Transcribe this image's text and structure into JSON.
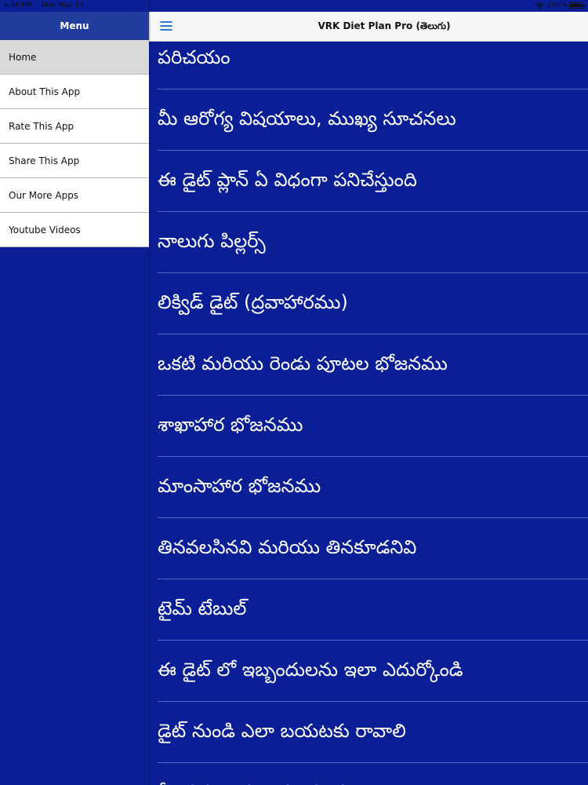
{
  "status_bar": {
    "time": "4:34 PM",
    "date": "Mon May 13",
    "battery": "100%",
    "battery_level": 1.0
  },
  "sidebar": {
    "title": "Menu",
    "items": [
      {
        "label": "Home",
        "active": true
      },
      {
        "label": "About This App"
      },
      {
        "label": "Rate This App"
      },
      {
        "label": "Share This App"
      },
      {
        "label": "Our More Apps"
      },
      {
        "label": "Youtube Videos"
      }
    ]
  },
  "nav": {
    "title": "VRK Diet Plan Pro (తెలుగు)"
  },
  "topics": [
    "పరిచయం",
    "మీ ఆరోగ్య విషయాలు, ముఖ్య సూచనలు",
    "ఈ డైట్ ప్లాన్ ఏ విధంగా పనిచేస్తుంది",
    "నాలుగు పిల్లర్స్",
    "లిక్విడ్ డైట్ (ద్రవాహారము)",
    "ఒకటి మరియు రెండు పూటల భోజనము",
    "శాఖాహార భోజనము",
    "మాంసాహార భోజనము",
    "తినవలసినవి మరియు తినకూడనివి",
    "టైమ్ టేబుల్",
    "ఈ డైట్ లో ఇబ్బందులను ఇలా ఎదుర్కోండి",
    "డైట్ నుండి ఎలా బయటకు రావాలి",
    "మీ ప్రశ్నలు మరియు సలహాలు"
  ],
  "colors": {
    "main_background": "#0a1e96",
    "sidebar_header": "#213e9e",
    "accent": "#2e7ed8"
  }
}
